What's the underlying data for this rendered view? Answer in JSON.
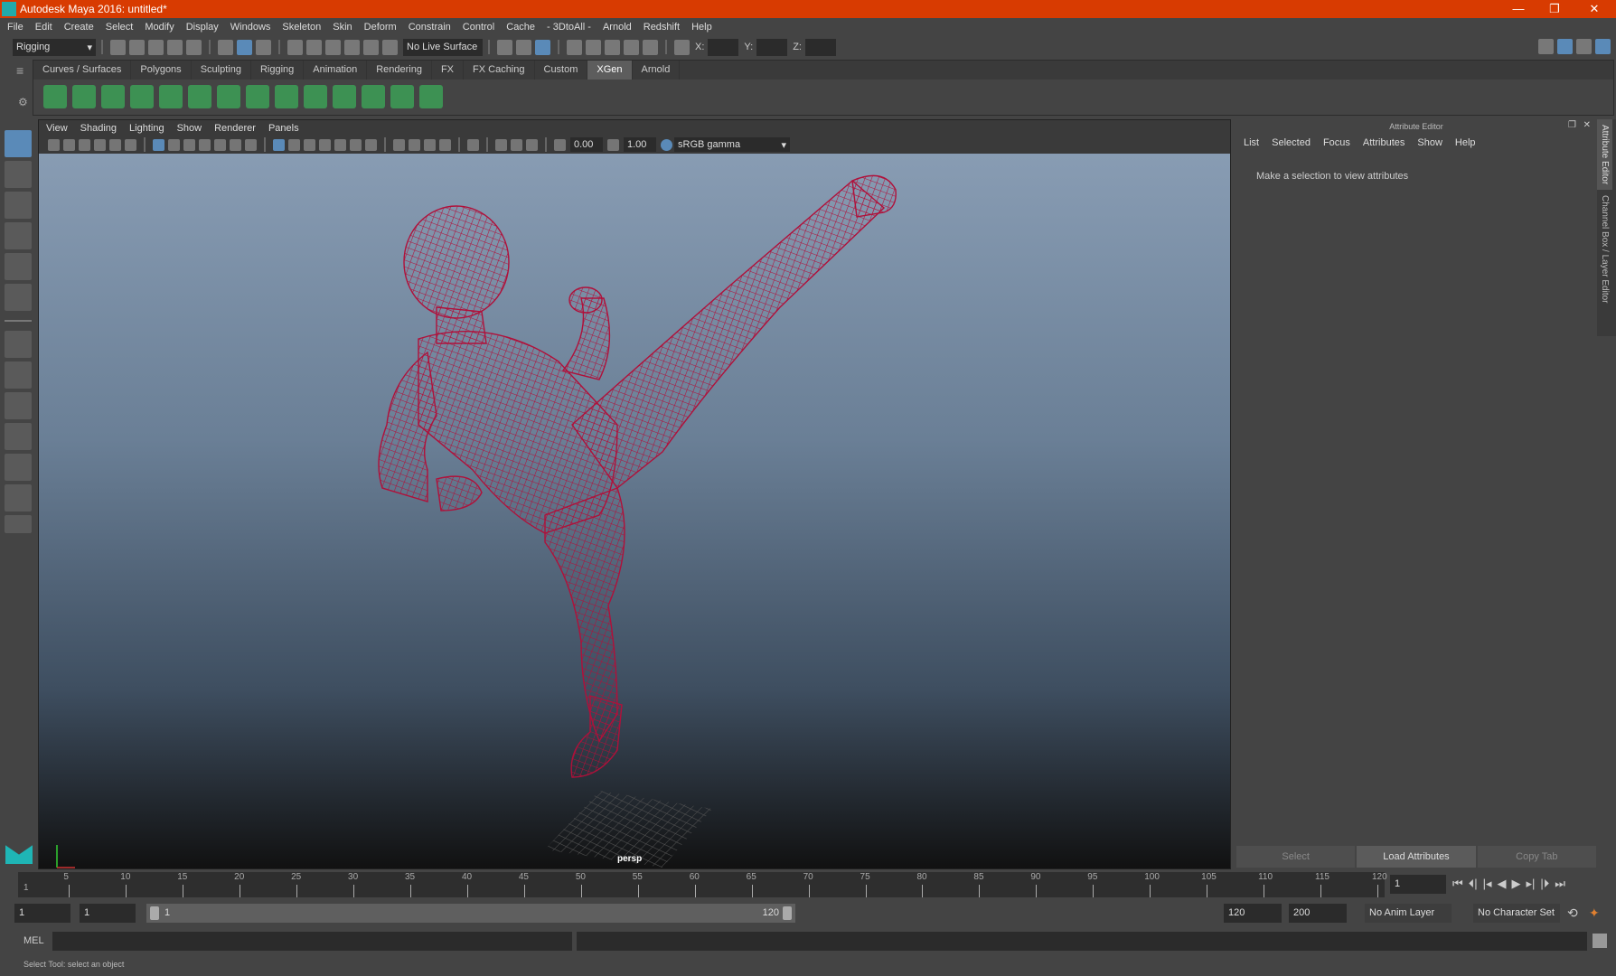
{
  "title": "Autodesk Maya 2016: untitled*",
  "window_controls": [
    "—",
    "❐",
    "✕"
  ],
  "menus": [
    "File",
    "Edit",
    "Create",
    "Select",
    "Modify",
    "Display",
    "Windows",
    "Skeleton",
    "Skin",
    "Deform",
    "Constrain",
    "Control",
    "Cache",
    "- 3DtoAll -",
    "Arnold",
    "Redshift",
    "Help"
  ],
  "status_line": {
    "menu_set": "Rigging",
    "live_surface": "No Live Surface",
    "x_label": "X:",
    "y_label": "Y:",
    "z_label": "Z:"
  },
  "shelf": {
    "tabs": [
      "Curves / Surfaces",
      "Polygons",
      "Sculpting",
      "Rigging",
      "Animation",
      "Rendering",
      "FX",
      "FX Caching",
      "Custom",
      "XGen",
      "Arnold"
    ],
    "active_tab": "XGen",
    "icons": [
      "xgen-editor-icon",
      "preview-icon",
      "clear-preview-icon",
      "create-description-icon",
      "import-icon",
      "add-guide-icon",
      "sculpt-guide-icon",
      "lock-guide-icon",
      "guide-length-icon",
      "groom-icon",
      "flip-guide-icon",
      "select-guide-icon",
      "rebuild-guide-icon",
      "delete-guide-icon"
    ]
  },
  "viewport": {
    "menus": [
      "View",
      "Shading",
      "Lighting",
      "Show",
      "Renderer",
      "Panels"
    ],
    "exposure": "0.00",
    "gamma": "1.00",
    "color_space": "sRGB gamma",
    "camera": "persp"
  },
  "attribute_editor": {
    "title": "Attribute Editor",
    "menus": [
      "List",
      "Selected",
      "Focus",
      "Attributes",
      "Show",
      "Help"
    ],
    "message": "Make a selection to view attributes",
    "buttons": [
      "Select",
      "Load Attributes",
      "Copy Tab"
    ],
    "side_tabs": [
      "Attribute Editor",
      "Channel Box / Layer Editor"
    ]
  },
  "timeline": {
    "ticks": [
      5,
      10,
      15,
      20,
      25,
      30,
      35,
      40,
      45,
      50,
      55,
      60,
      65,
      70,
      75,
      80,
      85,
      90,
      95,
      100,
      105,
      110,
      115,
      120
    ],
    "start_label": "1",
    "current_frame": "1"
  },
  "range": {
    "start": "1",
    "playback_start": "1",
    "slider_start": "1",
    "slider_end": "120",
    "playback_end": "120",
    "end": "200",
    "anim_layer": "No Anim Layer",
    "character_set": "No Character Set"
  },
  "playback_controls": [
    "⏮",
    "⏴|",
    "|◂",
    "◀",
    "▶",
    "▸|",
    "|⏵",
    "⏭"
  ],
  "command_line": {
    "label": "MEL"
  },
  "help_line": "Select Tool: select an object",
  "colors": {
    "title_bar": "#d83b01",
    "wireframe": "#b0103a",
    "accent": "#5a8ab8"
  }
}
